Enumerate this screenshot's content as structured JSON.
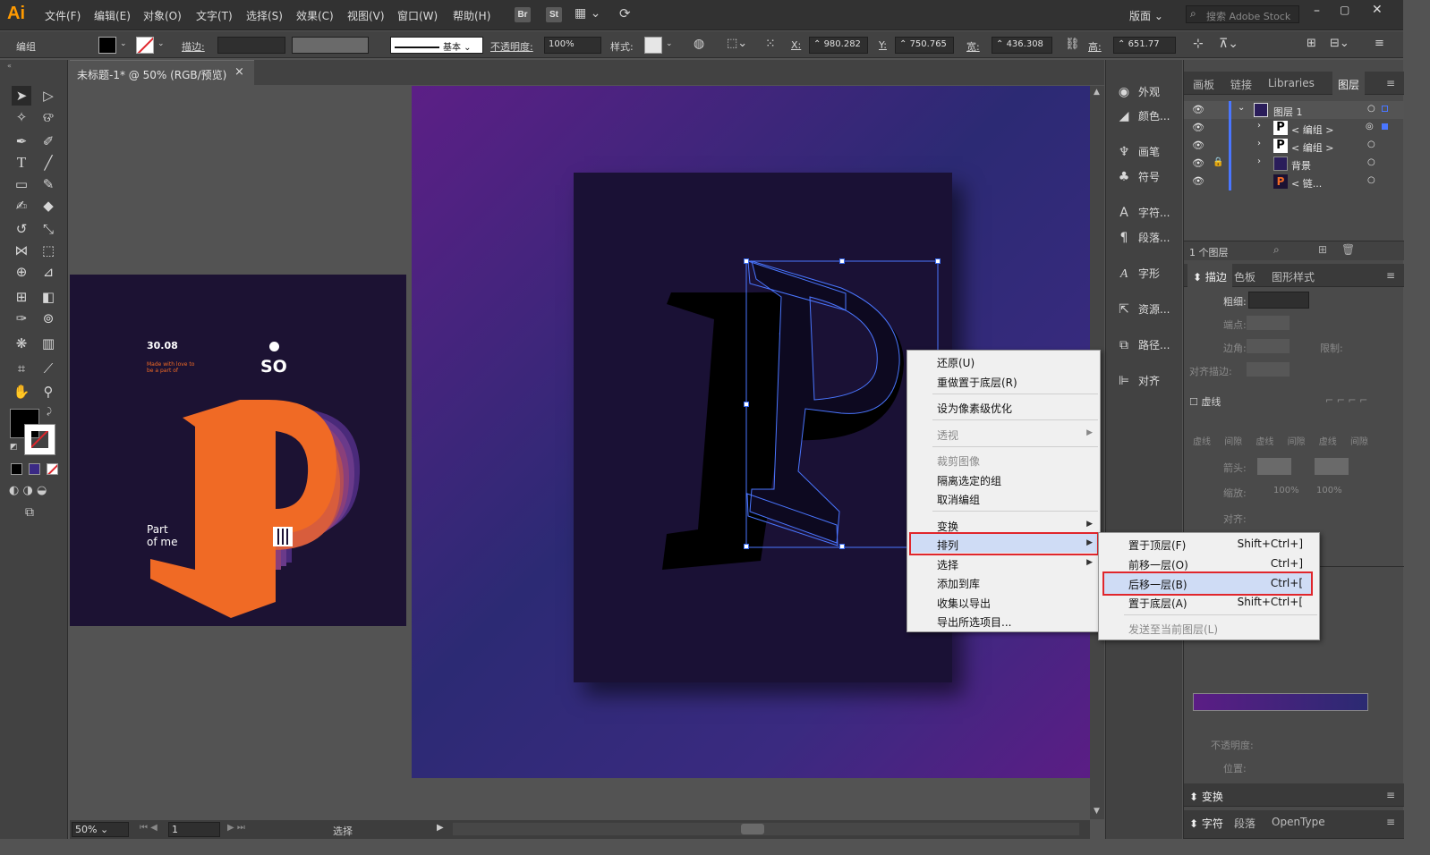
{
  "app": {
    "logo": "Ai",
    "workspace": "版面",
    "search_placeholder": "搜索 Adobe Stock"
  },
  "menubar": {
    "items": [
      "文件(F)",
      "编辑(E)",
      "对象(O)",
      "文字(T)",
      "选择(S)",
      "效果(C)",
      "视图(V)",
      "窗口(W)",
      "帮助(H)"
    ],
    "bridge": [
      "Br",
      "St"
    ]
  },
  "control": {
    "selection": "编组",
    "stroke_label": "描边:",
    "line_style": "基本",
    "opacity_label": "不透明度:",
    "opacity": "100%",
    "style_label": "样式:",
    "x_label": "X:",
    "x": "980.282",
    "y_label": "Y:",
    "y": "750.765",
    "w_label": "宽:",
    "w": "436.308",
    "h_label": "高:",
    "h": "651.77"
  },
  "document": {
    "tab": "未标题-1* @ 50% (RGB/预览)",
    "close": "×"
  },
  "thumbnail": {
    "date": "30.08",
    "tagline": "Made with love to be a part of",
    "brand": "SO",
    "bottom1": "Part",
    "bottom2": "of me"
  },
  "status": {
    "zoom": "50%",
    "page": "1",
    "mode": "选择"
  },
  "icon_panel": [
    {
      "label": "外观",
      "icon": "appearance-icon"
    },
    {
      "label": "颜色...",
      "icon": "color-icon"
    },
    {
      "label": "画笔",
      "icon": "brush-icon"
    },
    {
      "label": "符号",
      "icon": "symbol-icon"
    },
    {
      "label": "字符...",
      "icon": "character-icon"
    },
    {
      "label": "段落...",
      "icon": "paragraph-icon"
    },
    {
      "label": "字形",
      "icon": "glyph-icon"
    },
    {
      "label": "资源...",
      "icon": "assets-icon"
    },
    {
      "label": "路径...",
      "icon": "pathfinder-icon"
    },
    {
      "label": "对齐",
      "icon": "align-icon"
    }
  ],
  "panels": {
    "tabs_top": [
      "画板",
      "链接",
      "Libraries",
      "图层"
    ],
    "layers": [
      "图层 1",
      "< 编组 >",
      "< 编组 >",
      "背景",
      "< 链..."
    ],
    "layer_count": "1 个图层",
    "tabs_stroke": [
      "描边",
      "色板",
      "图形样式"
    ],
    "stroke": {
      "weight": "粗细:",
      "cap": "端点:",
      "corner": "边角:",
      "limit": "限制:",
      "align": "对齐描边:",
      "dashed": "虚线",
      "dash": "虚线",
      "gap": "间隙",
      "arrow": "箭头:",
      "scale": "缩放:",
      "scale1": "100%",
      "scale2": "100%",
      "align2": "对齐:"
    },
    "gradient": {
      "opacity": "不透明度:",
      "position": "位置:"
    },
    "bottom_tabs": [
      "变换",
      "字符",
      "段落",
      "OpenType"
    ]
  },
  "context_menu": {
    "items": [
      {
        "label": "还原(U)",
        "disabled": false
      },
      {
        "label": "重做置于底层(R)",
        "disabled": false
      },
      {
        "label": "设为像素级优化",
        "disabled": false
      },
      {
        "label": "透视",
        "disabled": true
      },
      {
        "label": "裁剪图像",
        "disabled": true
      },
      {
        "label": "隔离选定的组",
        "disabled": false
      },
      {
        "label": "取消编组",
        "disabled": false
      },
      {
        "label": "变换",
        "disabled": false
      },
      {
        "label": "排列",
        "disabled": false
      },
      {
        "label": "选择",
        "disabled": false
      },
      {
        "label": "添加到库",
        "disabled": false
      },
      {
        "label": "收集以导出",
        "disabled": false
      },
      {
        "label": "导出所选项目...",
        "disabled": false
      }
    ]
  },
  "arrange_submenu": {
    "items": [
      {
        "label": "置于顶层(F)",
        "shortcut": "Shift+Ctrl+]"
      },
      {
        "label": "前移一层(O)",
        "shortcut": "Ctrl+]"
      },
      {
        "label": "后移一层(B)",
        "shortcut": "Ctrl+["
      },
      {
        "label": "置于底层(A)",
        "shortcut": "Shift+Ctrl+["
      },
      {
        "label": "发送至当前图层(L)",
        "shortcut": ""
      }
    ]
  },
  "colors": {
    "accent": "#ff9a00",
    "highlight": "#e0262c",
    "selection": "#3a6cf0",
    "poster_orange": "#f06a25"
  }
}
